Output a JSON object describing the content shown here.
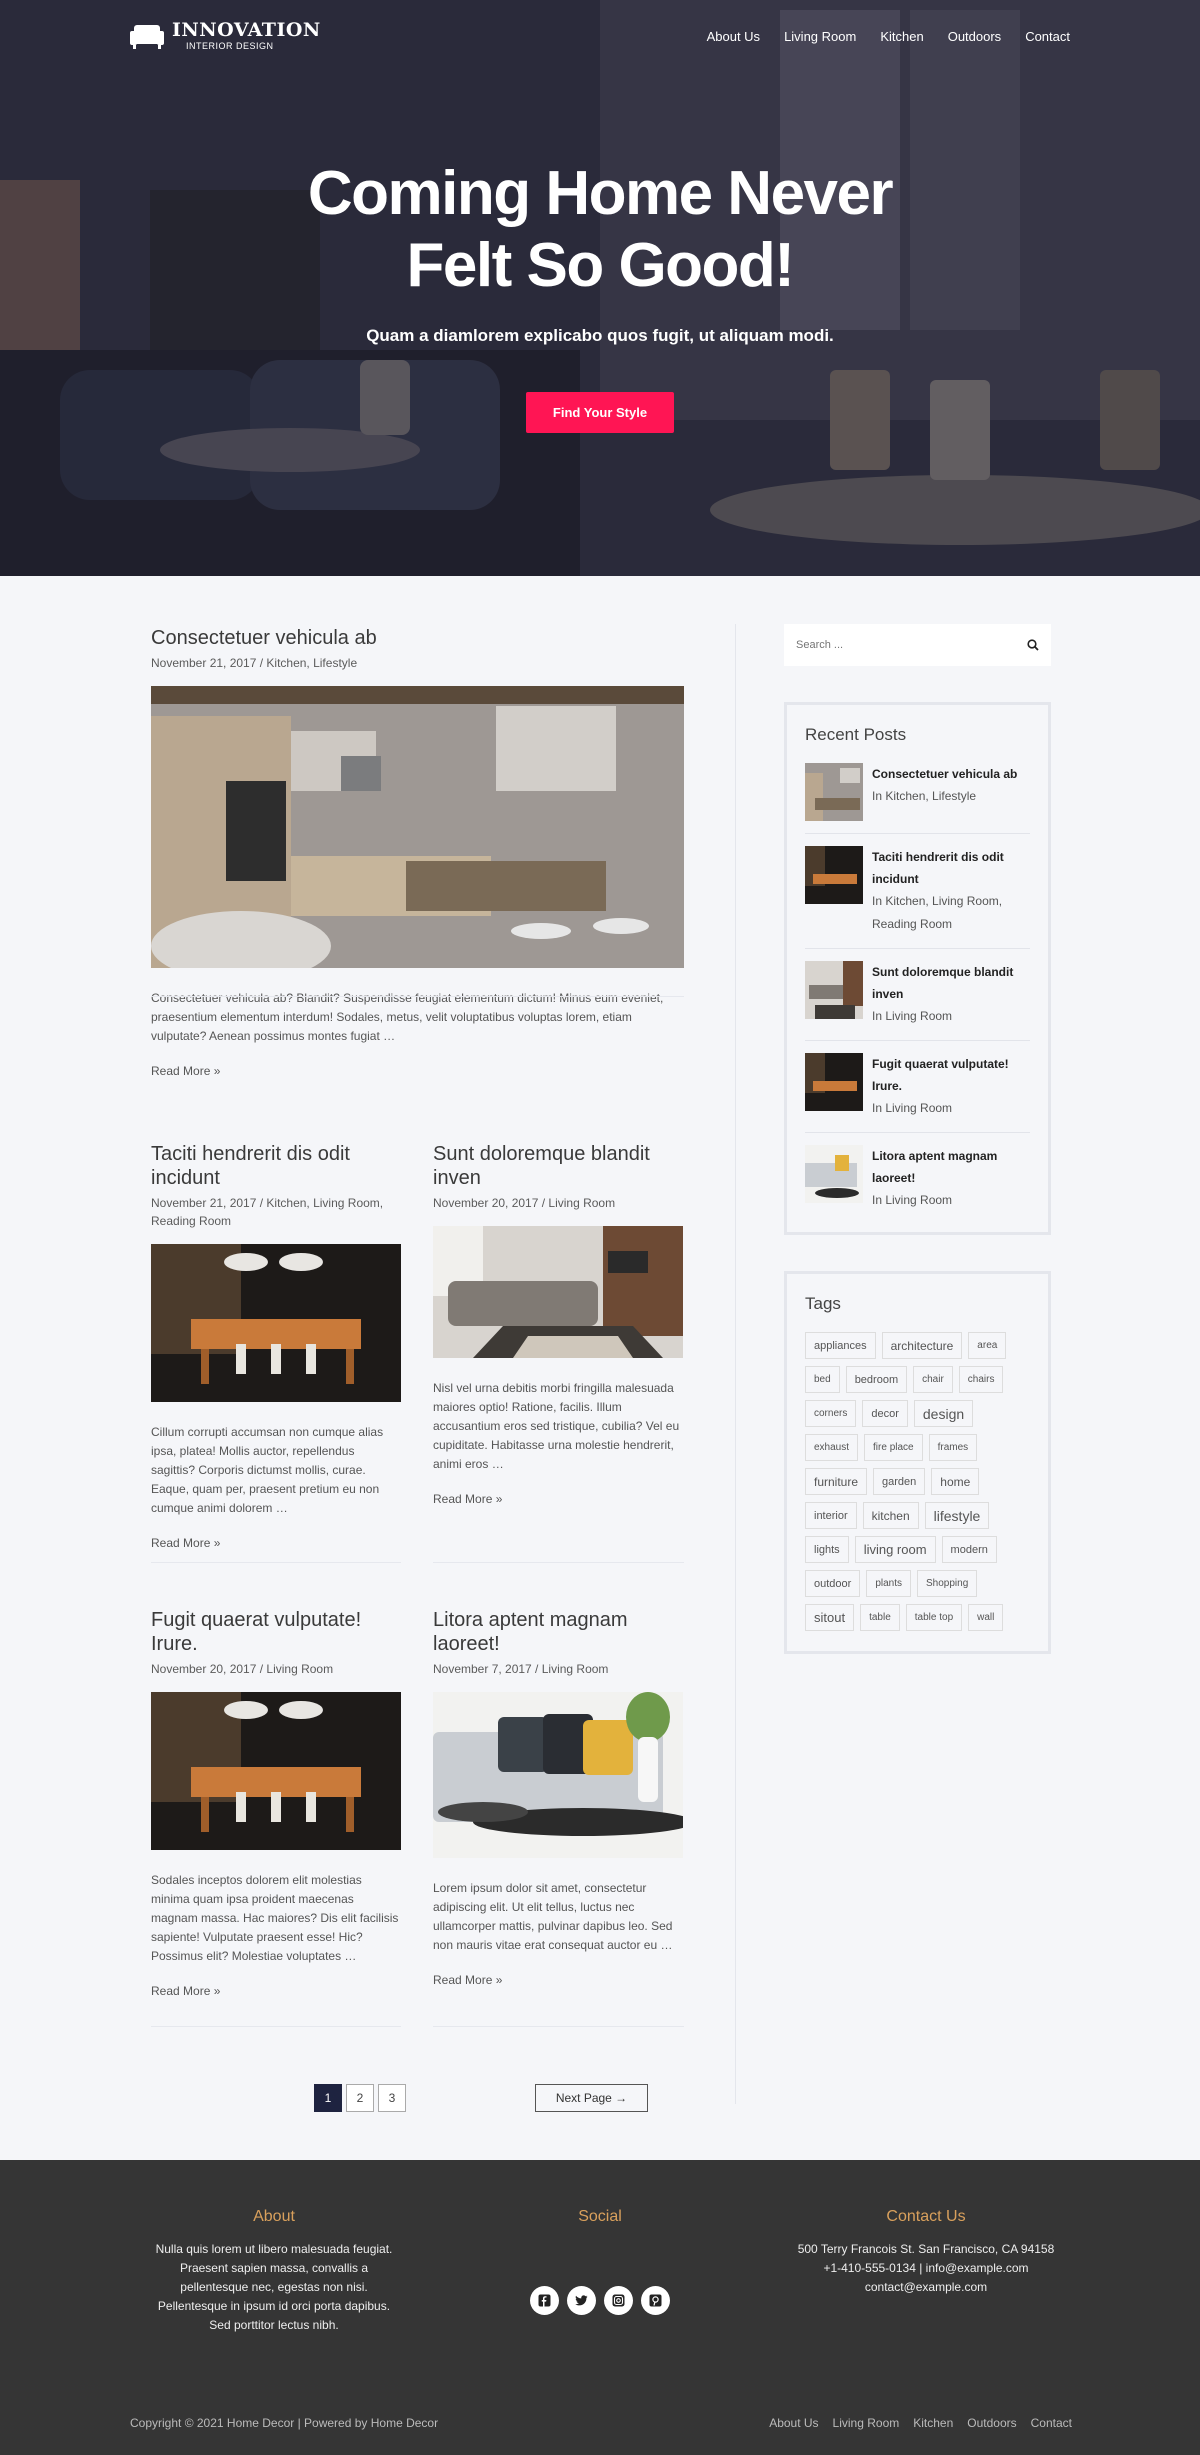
{
  "brand": {
    "name": "INNOVATION",
    "tagline": "INTERIOR DESIGN"
  },
  "nav": [
    "About Us",
    "Living Room",
    "Kitchen",
    "Outdoors",
    "Contact"
  ],
  "hero": {
    "title": "Coming Home Never Felt So Good!",
    "subtitle": "Quam a diamlorem explicabo quos fugit, ut aliquam modi.",
    "button": "Find Your Style"
  },
  "posts": [
    {
      "title": "Consectetuer vehicula ab",
      "meta": "November 21, 2017 / Kitchen, Lifestyle",
      "excerpt": "Consectetuer vehicula ab? Blandit? Suspendisse feugiat elementum dictum! Minus eum eveniet, praesentium elementum interdum! Sodales, metus, velit voluptatibus voluptas lorem, etiam vulputate? Aenean possimus montes fugiat …",
      "read_more": "Read More »"
    },
    {
      "title": "Taciti hendrerit dis odit incidunt",
      "meta": "November 21, 2017 / Kitchen, Living Room, Reading Room",
      "excerpt": "Cillum corrupti accumsan non cumque alias ipsa, platea! Mollis auctor, repellendus sagittis? Corporis dictumst mollis, curae. Eaque, quam per, praesent pretium eu non cumque animi dolorem …",
      "read_more": "Read More »"
    },
    {
      "title": "Sunt doloremque blandit inven",
      "meta": "November 20, 2017 / Living Room",
      "excerpt": "Nisl vel urna debitis morbi fringilla malesuada maiores optio! Ratione, facilis. Illum accusantium eros sed tristique, cubilia? Vel eu cupiditate. Habitasse urna molestie hendrerit, animi eros …",
      "read_more": "Read More »"
    },
    {
      "title": "Fugit quaerat vulputate! Irure.",
      "meta": "November 20, 2017 / Living Room",
      "excerpt": "Sodales inceptos dolorem elit molestias minima quam ipsa proident maecenas magnam massa. Hac maiores? Dis elit facilisis sapiente! Vulputate praesent esse! Hic? Possimus elit? Molestiae voluptates …",
      "read_more": "Read More »"
    },
    {
      "title": "Litora aptent magnam laoreet!",
      "meta": "November 7, 2017 / Living Room",
      "excerpt": "Lorem ipsum dolor sit amet, consectetur adipiscing elit. Ut elit tellus, luctus nec ullamcorper mattis, pulvinar dapibus leo. Sed non mauris vitae erat consequat auctor eu …",
      "read_more": "Read More »"
    }
  ],
  "pagination": {
    "pages": [
      "1",
      "2",
      "3"
    ],
    "current": "1",
    "next": "Next Page →"
  },
  "sidebar": {
    "search_placeholder": "Search ...",
    "recent_title": "Recent Posts",
    "recent": [
      {
        "title": "Consectetuer vehicula ab",
        "cat": "In Kitchen, Lifestyle"
      },
      {
        "title": "Taciti hendrerit dis odit incidunt",
        "cat": "In Kitchen, Living Room, Reading Room"
      },
      {
        "title": "Sunt doloremque blandit inven",
        "cat": "In Living Room"
      },
      {
        "title": "Fugit quaerat vulputate! Irure.",
        "cat": "In Living Room"
      },
      {
        "title": "Litora aptent magnam laoreet!",
        "cat": "In Living Room"
      }
    ],
    "tags_title": "Tags",
    "tags": [
      "appliances",
      "architecture",
      "area",
      "bed",
      "bedroom",
      "chair",
      "chairs",
      "corners",
      "decor",
      "design",
      "exhaust",
      "fire place",
      "frames",
      "furniture",
      "garden",
      "home",
      "interior",
      "kitchen",
      "lifestyle",
      "lights",
      "living room",
      "modern",
      "outdoor",
      "plants",
      "Shopping",
      "sitout",
      "table",
      "table top",
      "wall"
    ]
  },
  "footer": {
    "about_title": "About",
    "about_text": "Nulla quis lorem ut libero malesuada feugiat. Praesent sapien massa, convallis a pellentesque nec, egestas non nisi. Pellentesque in ipsum id orci porta dapibus. Sed porttitor lectus nibh.",
    "social_title": "Social",
    "social_icons": [
      "facebook-icon",
      "twitter-icon",
      "instagram-icon",
      "pinterest-icon"
    ],
    "contact_title": "Contact Us",
    "contact_lines": [
      "500 Terry Francois St. San Francisco, CA 94158",
      "+1-410-555-0134 | info@example.com",
      "contact@example.com"
    ],
    "copyright": "Copyright © 2021 Home Decor | Powered by Home Decor",
    "links": [
      "About Us",
      "Living Room",
      "Kitchen",
      "Outdoors",
      "Contact"
    ]
  },
  "colors": {
    "accent": "#ff1554",
    "footer_bg": "#353535",
    "footer_heading": "#d9a05c",
    "page_bg": "#f5f6f9"
  }
}
